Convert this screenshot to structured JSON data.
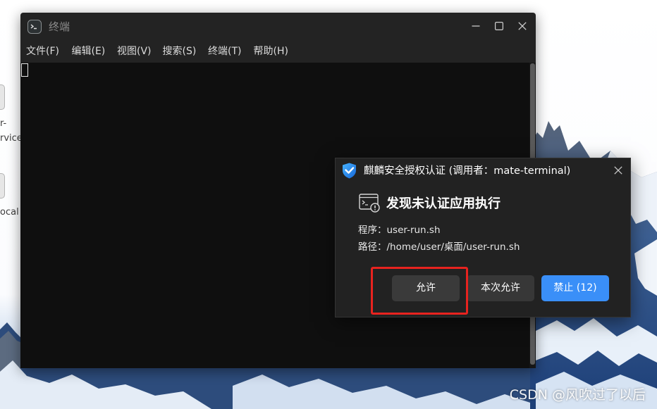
{
  "desktop": {
    "icons": [
      {
        "icon": "file-icon",
        "label_lines": [
          "r-",
          "rvice"
        ]
      },
      {
        "icon": "file-icon",
        "label_lines": [
          "ocal"
        ]
      }
    ],
    "watermark": "CSDN @风吹过了以后"
  },
  "terminal": {
    "title": "终端",
    "app_icon": "terminal-app-icon",
    "window_controls": [
      "minimize-icon",
      "maximize-icon",
      "close-icon"
    ],
    "menu": [
      "文件(F)",
      "编辑(E)",
      "视图(V)",
      "搜索(S)",
      "终端(T)",
      "帮助(H)"
    ]
  },
  "dialog": {
    "title": "麒麟安全授权认证 (调用者：mate-terminal)",
    "title_icon": "shield-check-icon",
    "close_icon": "close-icon",
    "alert_icon": "terminal-warning-icon",
    "heading": "发现未认证应用执行",
    "program": {
      "label": "程序：",
      "value": "user-run.sh"
    },
    "path": {
      "label": "路径：",
      "value": "/home/user/桌面/user-run.sh"
    },
    "buttons": {
      "allow": "允许",
      "allow_once": "本次允许",
      "deny": "禁止 (12)"
    }
  },
  "colors": {
    "terminal_bg": "#0f0f0f",
    "window_bg": "#232323",
    "dialog_bg": "#222222",
    "button_secondary": "#3a3a3a",
    "button_primary": "#3a8ff8",
    "annotation_border": "#e8231f",
    "shield_blue": "#1e7fe6"
  }
}
